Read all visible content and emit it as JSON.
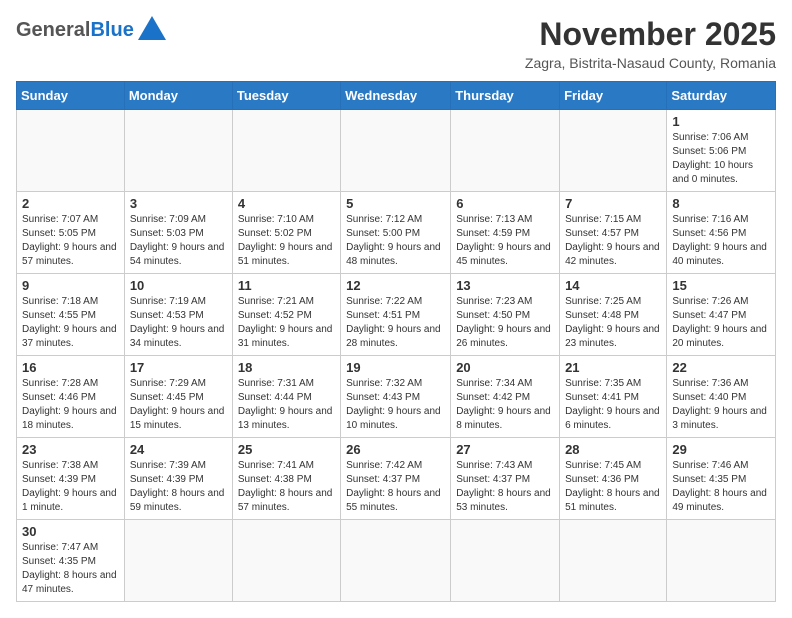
{
  "header": {
    "logo_general": "General",
    "logo_blue": "Blue",
    "month": "November 2025",
    "location": "Zagra, Bistrita-Nasaud County, Romania"
  },
  "weekdays": [
    "Sunday",
    "Monday",
    "Tuesday",
    "Wednesday",
    "Thursday",
    "Friday",
    "Saturday"
  ],
  "weeks": [
    [
      {
        "day": "",
        "info": ""
      },
      {
        "day": "",
        "info": ""
      },
      {
        "day": "",
        "info": ""
      },
      {
        "day": "",
        "info": ""
      },
      {
        "day": "",
        "info": ""
      },
      {
        "day": "",
        "info": ""
      },
      {
        "day": "1",
        "info": "Sunrise: 7:06 AM\nSunset: 5:06 PM\nDaylight: 10 hours and 0 minutes."
      }
    ],
    [
      {
        "day": "2",
        "info": "Sunrise: 7:07 AM\nSunset: 5:05 PM\nDaylight: 9 hours and 57 minutes."
      },
      {
        "day": "3",
        "info": "Sunrise: 7:09 AM\nSunset: 5:03 PM\nDaylight: 9 hours and 54 minutes."
      },
      {
        "day": "4",
        "info": "Sunrise: 7:10 AM\nSunset: 5:02 PM\nDaylight: 9 hours and 51 minutes."
      },
      {
        "day": "5",
        "info": "Sunrise: 7:12 AM\nSunset: 5:00 PM\nDaylight: 9 hours and 48 minutes."
      },
      {
        "day": "6",
        "info": "Sunrise: 7:13 AM\nSunset: 4:59 PM\nDaylight: 9 hours and 45 minutes."
      },
      {
        "day": "7",
        "info": "Sunrise: 7:15 AM\nSunset: 4:57 PM\nDaylight: 9 hours and 42 minutes."
      },
      {
        "day": "8",
        "info": "Sunrise: 7:16 AM\nSunset: 4:56 PM\nDaylight: 9 hours and 40 minutes."
      }
    ],
    [
      {
        "day": "9",
        "info": "Sunrise: 7:18 AM\nSunset: 4:55 PM\nDaylight: 9 hours and 37 minutes."
      },
      {
        "day": "10",
        "info": "Sunrise: 7:19 AM\nSunset: 4:53 PM\nDaylight: 9 hours and 34 minutes."
      },
      {
        "day": "11",
        "info": "Sunrise: 7:21 AM\nSunset: 4:52 PM\nDaylight: 9 hours and 31 minutes."
      },
      {
        "day": "12",
        "info": "Sunrise: 7:22 AM\nSunset: 4:51 PM\nDaylight: 9 hours and 28 minutes."
      },
      {
        "day": "13",
        "info": "Sunrise: 7:23 AM\nSunset: 4:50 PM\nDaylight: 9 hours and 26 minutes."
      },
      {
        "day": "14",
        "info": "Sunrise: 7:25 AM\nSunset: 4:48 PM\nDaylight: 9 hours and 23 minutes."
      },
      {
        "day": "15",
        "info": "Sunrise: 7:26 AM\nSunset: 4:47 PM\nDaylight: 9 hours and 20 minutes."
      }
    ],
    [
      {
        "day": "16",
        "info": "Sunrise: 7:28 AM\nSunset: 4:46 PM\nDaylight: 9 hours and 18 minutes."
      },
      {
        "day": "17",
        "info": "Sunrise: 7:29 AM\nSunset: 4:45 PM\nDaylight: 9 hours and 15 minutes."
      },
      {
        "day": "18",
        "info": "Sunrise: 7:31 AM\nSunset: 4:44 PM\nDaylight: 9 hours and 13 minutes."
      },
      {
        "day": "19",
        "info": "Sunrise: 7:32 AM\nSunset: 4:43 PM\nDaylight: 9 hours and 10 minutes."
      },
      {
        "day": "20",
        "info": "Sunrise: 7:34 AM\nSunset: 4:42 PM\nDaylight: 9 hours and 8 minutes."
      },
      {
        "day": "21",
        "info": "Sunrise: 7:35 AM\nSunset: 4:41 PM\nDaylight: 9 hours and 6 minutes."
      },
      {
        "day": "22",
        "info": "Sunrise: 7:36 AM\nSunset: 4:40 PM\nDaylight: 9 hours and 3 minutes."
      }
    ],
    [
      {
        "day": "23",
        "info": "Sunrise: 7:38 AM\nSunset: 4:39 PM\nDaylight: 9 hours and 1 minute."
      },
      {
        "day": "24",
        "info": "Sunrise: 7:39 AM\nSunset: 4:39 PM\nDaylight: 8 hours and 59 minutes."
      },
      {
        "day": "25",
        "info": "Sunrise: 7:41 AM\nSunset: 4:38 PM\nDaylight: 8 hours and 57 minutes."
      },
      {
        "day": "26",
        "info": "Sunrise: 7:42 AM\nSunset: 4:37 PM\nDaylight: 8 hours and 55 minutes."
      },
      {
        "day": "27",
        "info": "Sunrise: 7:43 AM\nSunset: 4:37 PM\nDaylight: 8 hours and 53 minutes."
      },
      {
        "day": "28",
        "info": "Sunrise: 7:45 AM\nSunset: 4:36 PM\nDaylight: 8 hours and 51 minutes."
      },
      {
        "day": "29",
        "info": "Sunrise: 7:46 AM\nSunset: 4:35 PM\nDaylight: 8 hours and 49 minutes."
      }
    ],
    [
      {
        "day": "30",
        "info": "Sunrise: 7:47 AM\nSunset: 4:35 PM\nDaylight: 8 hours and 47 minutes."
      },
      {
        "day": "",
        "info": ""
      },
      {
        "day": "",
        "info": ""
      },
      {
        "day": "",
        "info": ""
      },
      {
        "day": "",
        "info": ""
      },
      {
        "day": "",
        "info": ""
      },
      {
        "day": "",
        "info": ""
      }
    ]
  ]
}
